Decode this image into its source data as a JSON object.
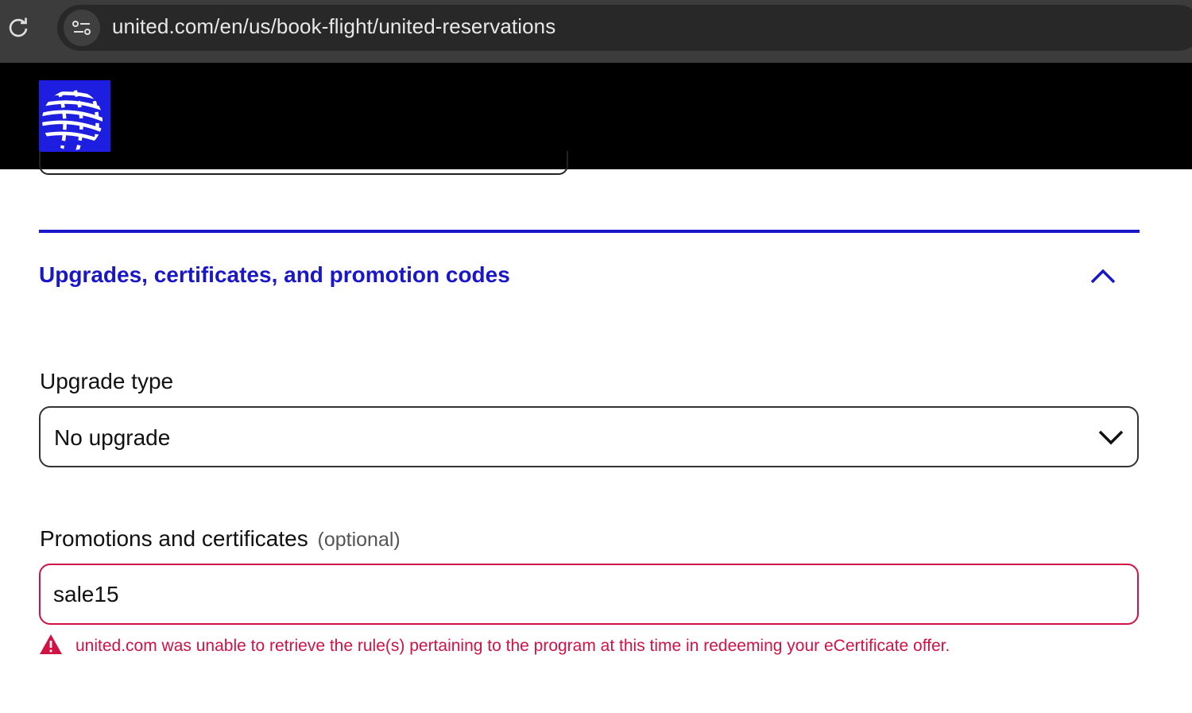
{
  "browser": {
    "url": "united.com/en/us/book-flight/united-reservations"
  },
  "header": {
    "logo_icon": "united-globe-logo",
    "brand_color": "#1d1ee0"
  },
  "section": {
    "title": "Upgrades, certificates, and promotion codes",
    "expanded": true,
    "accent_color": "#1a17c8"
  },
  "upgrade": {
    "label": "Upgrade type",
    "selected": "No upgrade"
  },
  "promo": {
    "label": "Promotions and certificates",
    "optional_label": "(optional)",
    "value": "sale15",
    "error_color": "#d11245",
    "error_message": "united.com was unable to retrieve the rule(s) pertaining to the program at this time in redeeming your eCertificate offer."
  }
}
